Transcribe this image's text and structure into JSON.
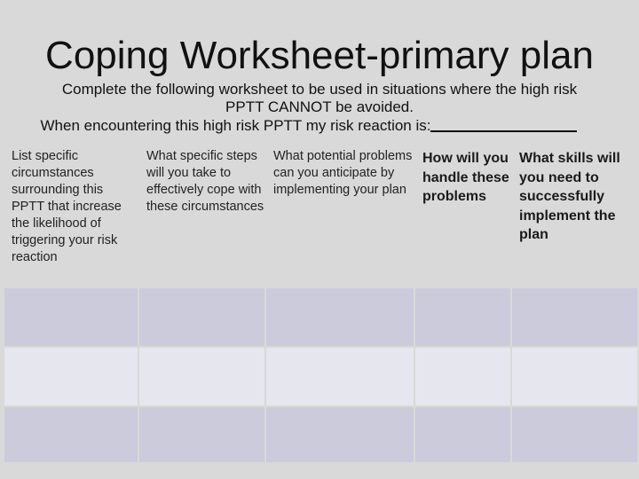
{
  "title": "Coping Worksheet-primary plan",
  "instructions": {
    "line1": "Complete the following worksheet to be used in situations where the high risk",
    "line2": "PPTT CANNOT be avoided.",
    "line3": "When encountering this high risk PPTT my risk reaction is:"
  },
  "table": {
    "headers": [
      "List specific circumstances surrounding this PPTT that increase the likelihood of triggering your risk reaction",
      "What specific steps will  you take to effectively cope with these circumstances",
      "What  potential problems can you anticipate by implementing your plan",
      "How will you handle these problems",
      "What skills will you need to successfully implement the plan"
    ],
    "rows": [
      [
        "",
        "",
        "",
        "",
        ""
      ],
      [
        "",
        "",
        "",
        "",
        ""
      ],
      [
        "",
        "",
        "",
        "",
        ""
      ]
    ],
    "colors": {
      "row_dark": "#cbcbdc",
      "row_light": "#e6e6ee",
      "background": "#d9d9d9"
    }
  }
}
